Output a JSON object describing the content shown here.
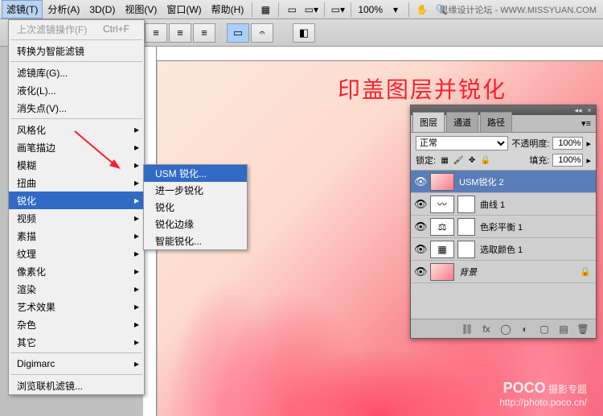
{
  "menubar": {
    "filter": "滤镜(T)",
    "analysis": "分析(A)",
    "3d": "3D(D)",
    "view": "视图(V)",
    "window": "窗口(W)",
    "help": "帮助(H)",
    "zoom": "100%"
  },
  "watermark_top": "思缘设计论坛 - WWW.MISSYUAN.COM",
  "filter_menu": {
    "last": "上次滤镜操作(F)",
    "last_shortcut": "Ctrl+F",
    "smart": "转换为智能滤镜",
    "gallery": "滤镜库(G)...",
    "liquefy": "液化(L)...",
    "vanishing": "消失点(V)...",
    "stylize": "风格化",
    "brush": "画笔描边",
    "blur": "模糊",
    "distort": "扭曲",
    "sharpen": "锐化",
    "video": "视频",
    "sketch": "素描",
    "texture": "纹理",
    "pixelate": "像素化",
    "render": "渲染",
    "artistic": "艺术效果",
    "noise": "杂色",
    "other": "其它",
    "digimarc": "Digimarc",
    "browse": "浏览联机滤镜..."
  },
  "sharpen_submenu": {
    "usm": "USM 锐化...",
    "further": "进一步锐化",
    "sharpen": "锐化",
    "edges": "锐化边缘",
    "smart": "智能锐化..."
  },
  "canvas": {
    "title": "印盖图层并锐化",
    "watermark_brand": "POCO",
    "watermark_text": "摄影专题",
    "watermark_url": "http://photo.poco.cn/"
  },
  "layers_panel": {
    "tabs": {
      "layers": "图层",
      "channels": "通道",
      "paths": "路径"
    },
    "blend_mode": "正常",
    "opacity_label": "不透明度:",
    "opacity_value": "100%",
    "lock_label": "锁定:",
    "fill_label": "填充:",
    "fill_value": "100%",
    "layers": [
      {
        "name": "USM锐化 2",
        "type": "img",
        "selected": true
      },
      {
        "name": "曲线 1",
        "type": "adj"
      },
      {
        "name": "色彩平衡 1",
        "type": "adj"
      },
      {
        "name": "选取颜色 1",
        "type": "adj"
      },
      {
        "name": "背景",
        "type": "bg",
        "locked": true
      }
    ]
  }
}
